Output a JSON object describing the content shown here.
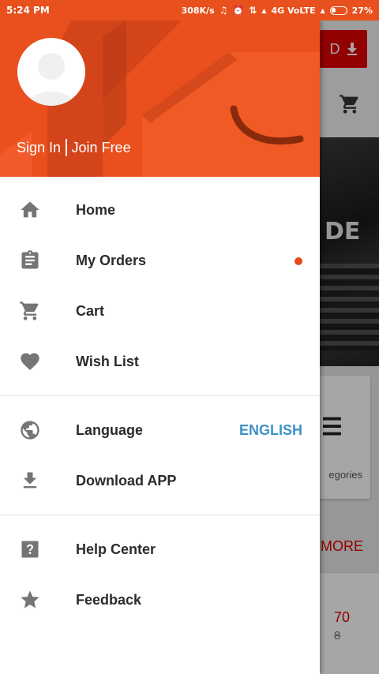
{
  "status_bar": {
    "time": "5:24 PM",
    "network_speed": "308K/s",
    "network_type": "4G VoLTE",
    "battery": "27%"
  },
  "drawer": {
    "header": {
      "sign_in": "Sign In",
      "join_free": "Join Free"
    },
    "menu_primary": [
      {
        "label": "Home",
        "icon": "home-icon"
      },
      {
        "label": "My Orders",
        "icon": "clipboard-icon",
        "has_badge": true
      },
      {
        "label": "Cart",
        "icon": "cart-icon"
      },
      {
        "label": "Wish List",
        "icon": "heart-icon"
      }
    ],
    "menu_settings": [
      {
        "label": "Language",
        "icon": "globe-icon",
        "value": "ENGLISH"
      },
      {
        "label": "Download APP",
        "icon": "download-icon"
      }
    ],
    "menu_support": [
      {
        "label": "Help Center",
        "icon": "help-icon"
      },
      {
        "label": "Feedback",
        "icon": "star-icon"
      }
    ]
  },
  "background_app": {
    "download_label_fragment": "D",
    "banner_text_fragment": "DE",
    "categories_fragment": "egories",
    "more_fragment": "MORE",
    "price_fragment": "70",
    "old_price_fragment": "8"
  },
  "colors": {
    "brand_orange": "#e9501e",
    "accent_blue": "#3d92c4",
    "badge_red": "#e64a19",
    "icon_gray": "#757575"
  }
}
